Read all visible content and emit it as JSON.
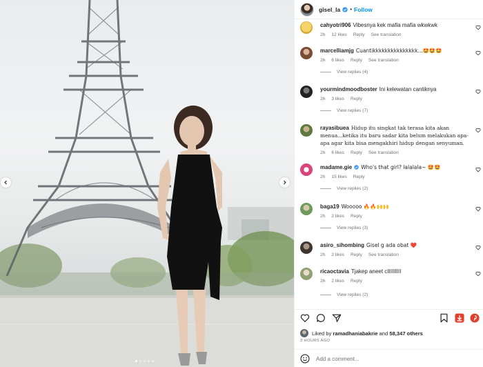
{
  "post": {
    "username": "gisel_la",
    "follow_label": "Follow",
    "separator": "•"
  },
  "comments": [
    {
      "user": "cahyotri906",
      "text": "Vibesnya kek mafia mafia wkwkwk",
      "time": "2h",
      "likes": "12 likes",
      "reply": "Reply",
      "translate": "See translation",
      "view_replies": null,
      "avatar_color": "#f0c14b"
    },
    {
      "user": "marcelliamjg",
      "text": "Cuantikkkkkkkkkkkkkkk...🤩🤩🤩",
      "time": "2h",
      "likes": "6 likes",
      "reply": "Reply",
      "translate": "See translation",
      "view_replies": "View replies (4)",
      "avatar_color": "#b97c5c"
    },
    {
      "user": "yourmindmoodboster",
      "text": "Ini kelewatan cantiknya",
      "time": "2h",
      "likes": "3 likes",
      "reply": "Reply",
      "translate": null,
      "view_replies": "View replies (7)",
      "avatar_color": "#3b3b3b"
    },
    {
      "user": "rayasibuea",
      "text": "Hidup itu singkat tak terasa kita akan menua...ketika itu baru sadar kita belum melakukan apa-apa agar kita bisa mengakhiri hidup dengan senyuman.",
      "time": "2h",
      "likes": "6 likes",
      "reply": "Reply",
      "translate": "See translation",
      "view_replies": null,
      "avatar_color": "#6f8a4e"
    },
    {
      "user": "madame.gie",
      "text": "Who's that girl? lalalala~ 🤩🤩",
      "time": "2h",
      "likes": "15 likes",
      "reply": "Reply",
      "translate": null,
      "view_replies": "View replies (2)",
      "avatar_color": "#d9447a"
    },
    {
      "user": "baga19",
      "text": "Wooooo 🔥🔥🙌🙌",
      "time": "2h",
      "likes": "2 likes",
      "reply": "Reply",
      "translate": null,
      "view_replies": "View replies (3)",
      "avatar_color": "#7aa36a"
    },
    {
      "user": "asiro_sihombing",
      "text": "Gisel g ada obat ❤️",
      "time": "2h",
      "likes": "2 likes",
      "reply": "Reply",
      "translate": "See translation",
      "view_replies": null,
      "avatar_color": "#5b5048"
    },
    {
      "user": "ricaoctavia",
      "text": "Tjakep aneet cIIIIIIIII",
      "time": "2h",
      "likes": "2 likes",
      "reply": "Reply",
      "translate": null,
      "view_replies": "View replies (2)",
      "avatar_color": "#8fa074"
    }
  ],
  "likes": {
    "prefix": "Liked by",
    "user": "ramadhaniabakrie",
    "middle": "and",
    "count": "58,347 others"
  },
  "timestamp": "3 HOURS AGO",
  "add_comment": {
    "placeholder": "Add a comment..."
  },
  "colors": {
    "accent": "#0095f6",
    "save_red": "#e3402c",
    "verified": "#3897f0"
  },
  "icons": [
    "chevron-left-icon",
    "chevron-right-icon",
    "heart-icon",
    "comment-icon",
    "share-icon",
    "bookmark-icon",
    "download-icon",
    "pinterest-icon",
    "emoji-icon",
    "verified-icon"
  ],
  "carousel": {
    "count": 5,
    "active_index": 0
  }
}
